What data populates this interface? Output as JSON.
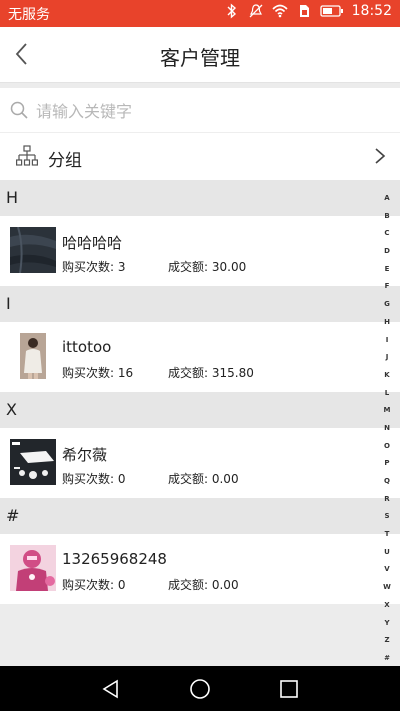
{
  "status_bar": {
    "carrier": "无服务",
    "time": "18:52"
  },
  "header": {
    "title": "客户管理"
  },
  "search": {
    "placeholder": "请输入关键字"
  },
  "group": {
    "label": "分组"
  },
  "sections": [
    {
      "letter": "H",
      "customers": [
        {
          "name": "哈哈哈哈",
          "purchases": "购买次数: 3",
          "amount": "成交额: 30.00",
          "thumb": "dark-fabric"
        }
      ]
    },
    {
      "letter": "I",
      "customers": [
        {
          "name": "ittotoo",
          "purchases": "购买次数: 16",
          "amount": "成交额: 315.80",
          "thumb": "person-photo"
        }
      ]
    },
    {
      "letter": "X",
      "customers": [
        {
          "name": "希尔薇",
          "purchases": "购买次数: 0",
          "amount": "成交额: 0.00",
          "thumb": "ceiling-lamp"
        }
      ]
    },
    {
      "letter": "#",
      "customers": [
        {
          "name": "13265968248",
          "purchases": "购买次数: 0",
          "amount": "成交额: 0.00",
          "thumb": "pink-robot"
        }
      ]
    }
  ],
  "index_letters": [
    "A",
    "B",
    "C",
    "D",
    "E",
    "F",
    "G",
    "H",
    "I",
    "J",
    "K",
    "L",
    "M",
    "N",
    "O",
    "P",
    "Q",
    "R",
    "S",
    "T",
    "U",
    "V",
    "W",
    "X",
    "Y",
    "Z",
    "#"
  ],
  "colors": {
    "status_bar": "#e8432b",
    "section_bg": "#e6e6e6",
    "page_bg": "#ececec"
  }
}
